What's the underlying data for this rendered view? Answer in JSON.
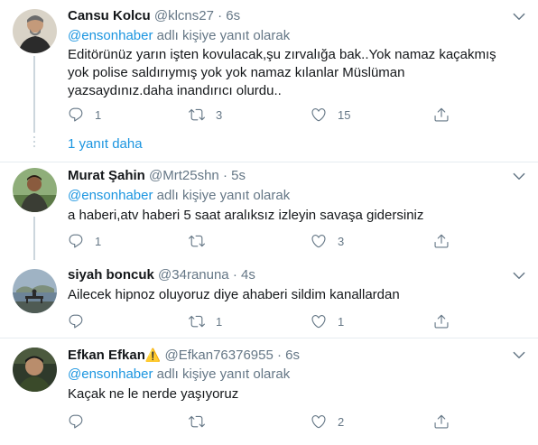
{
  "tweets": [
    {
      "name": "Cansu Kolcu",
      "handle": "@klcns27",
      "dot": "·",
      "time": "6s",
      "reply_prefix": "",
      "reply_mention": "@ensonhaber",
      "reply_suffix": " adlı kişiye yanıt olarak",
      "text": "Editörünüz yarın işten kovulacak,şu zırvalığa bak..Yok namaz kaçakmış yok polise saldırıymış yok yok namaz kılanlar Müslüman yazsaydınız.daha inandırıcı olurdu..",
      "reply_count": "1",
      "retweet_count": "3",
      "like_count": "15"
    },
    {
      "name": "Murat Şahin",
      "handle": "@Mrt25shn",
      "dot": "·",
      "time": "5s",
      "reply_mention": "@ensonhaber",
      "reply_suffix": " adlı kişiye yanıt olarak",
      "text": "a haberi,atv haberi  5 saat aralıksız izleyin savaşa gidersiniz",
      "reply_count": "1",
      "retweet_count": "",
      "like_count": "3"
    },
    {
      "name": "siyah boncuk",
      "handle": "@34ranuna",
      "dot": "·",
      "time": "4s",
      "text": "Ailecek hipnoz oluyoruz diye ahaberi sildim kanallardan",
      "reply_count": "",
      "retweet_count": "1",
      "like_count": "1"
    },
    {
      "name": "Efkan Efkan",
      "badge": "⚠️",
      "handle": "@Efkan76376955",
      "dot": "·",
      "time": "6s",
      "reply_mention": "@ensonhaber",
      "reply_suffix": " adlı kişiye yanıt olarak",
      "text": "Kaçak ne le nerde yaşıyoruz",
      "reply_count": "",
      "retweet_count": "",
      "like_count": "2"
    }
  ],
  "show_more": "1 yanıt daha",
  "icons": {
    "reply": "reply-icon",
    "retweet": "retweet-icon",
    "like": "heart-icon",
    "share": "share-icon",
    "more": "chevron-down-icon"
  },
  "colors": {
    "link": "#1b95e0",
    "muted": "#657786",
    "divider": "#e6ecf0",
    "text": "#14171a"
  }
}
